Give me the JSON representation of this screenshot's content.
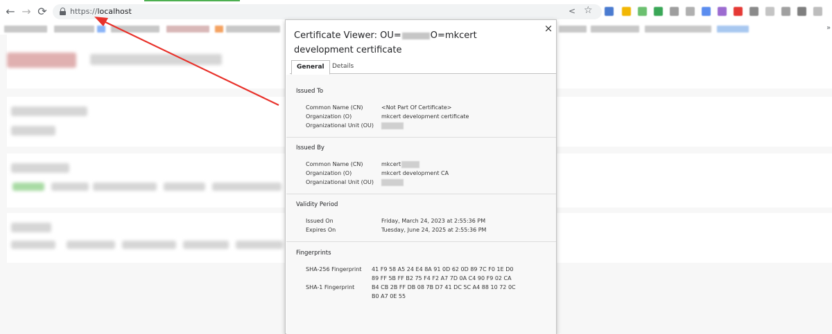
{
  "browser": {
    "url_scheme": "https://",
    "url_host": "localhost",
    "nav": {
      "back": "←",
      "forward": "→",
      "reload": "⟳"
    },
    "share_glyph": "<",
    "star_glyph": "☆",
    "extension_colors": [
      "#4a7bd0",
      "#f2b705",
      "#6cc070",
      "#3aa757",
      "#5b8def",
      "#9c27b0",
      "#e53935",
      "#5f6368"
    ]
  },
  "dialog": {
    "title_prefix": "Certificate Viewer: OU=",
    "title_suffix": "O=mkcert development certificate",
    "close_glyph": "×",
    "tabs": [
      "General",
      "Details"
    ],
    "issued_to": {
      "heading": "Issued To",
      "rows": [
        {
          "label": "Common Name (CN)",
          "value": "<Not Part Of Certificate>"
        },
        {
          "label": "Organization (O)",
          "value": "mkcert development certificate"
        },
        {
          "label": "Organizational Unit (OU)",
          "value": ""
        }
      ]
    },
    "issued_by": {
      "heading": "Issued By",
      "rows": [
        {
          "label": "Common Name (CN)",
          "value": "mkcert"
        },
        {
          "label": "Organization (O)",
          "value": "mkcert development CA"
        },
        {
          "label": "Organizational Unit (OU)",
          "value": ""
        }
      ]
    },
    "validity": {
      "heading": "Validity Period",
      "rows": [
        {
          "label": "Issued On",
          "value": "Friday, March 24, 2023 at 2:55:36 PM"
        },
        {
          "label": "Expires On",
          "value": "Tuesday, June 24, 2025 at 2:55:36 PM"
        }
      ]
    },
    "fingerprints": {
      "heading": "Fingerprints",
      "sha256": {
        "label": "SHA-256 Fingerprint",
        "line1": "41 F9 58 A5 24 E4 8A 91 0D 62 0D 89 7C F0 1E D0",
        "line2": "89 FF 5B FF B2 75 F4 F2 A7 7D 0A C4 90 F9 02 CA"
      },
      "sha1": {
        "label": "SHA-1 Fingerprint",
        "line1": "B4 CB 2B FF DB 08 7B D7 41 DC 5C A4 88 10 72 0C",
        "line2": "B0 A7 0E 55"
      }
    }
  },
  "colors": {
    "arrow": "#e8312a",
    "progress": "#4caf50"
  }
}
